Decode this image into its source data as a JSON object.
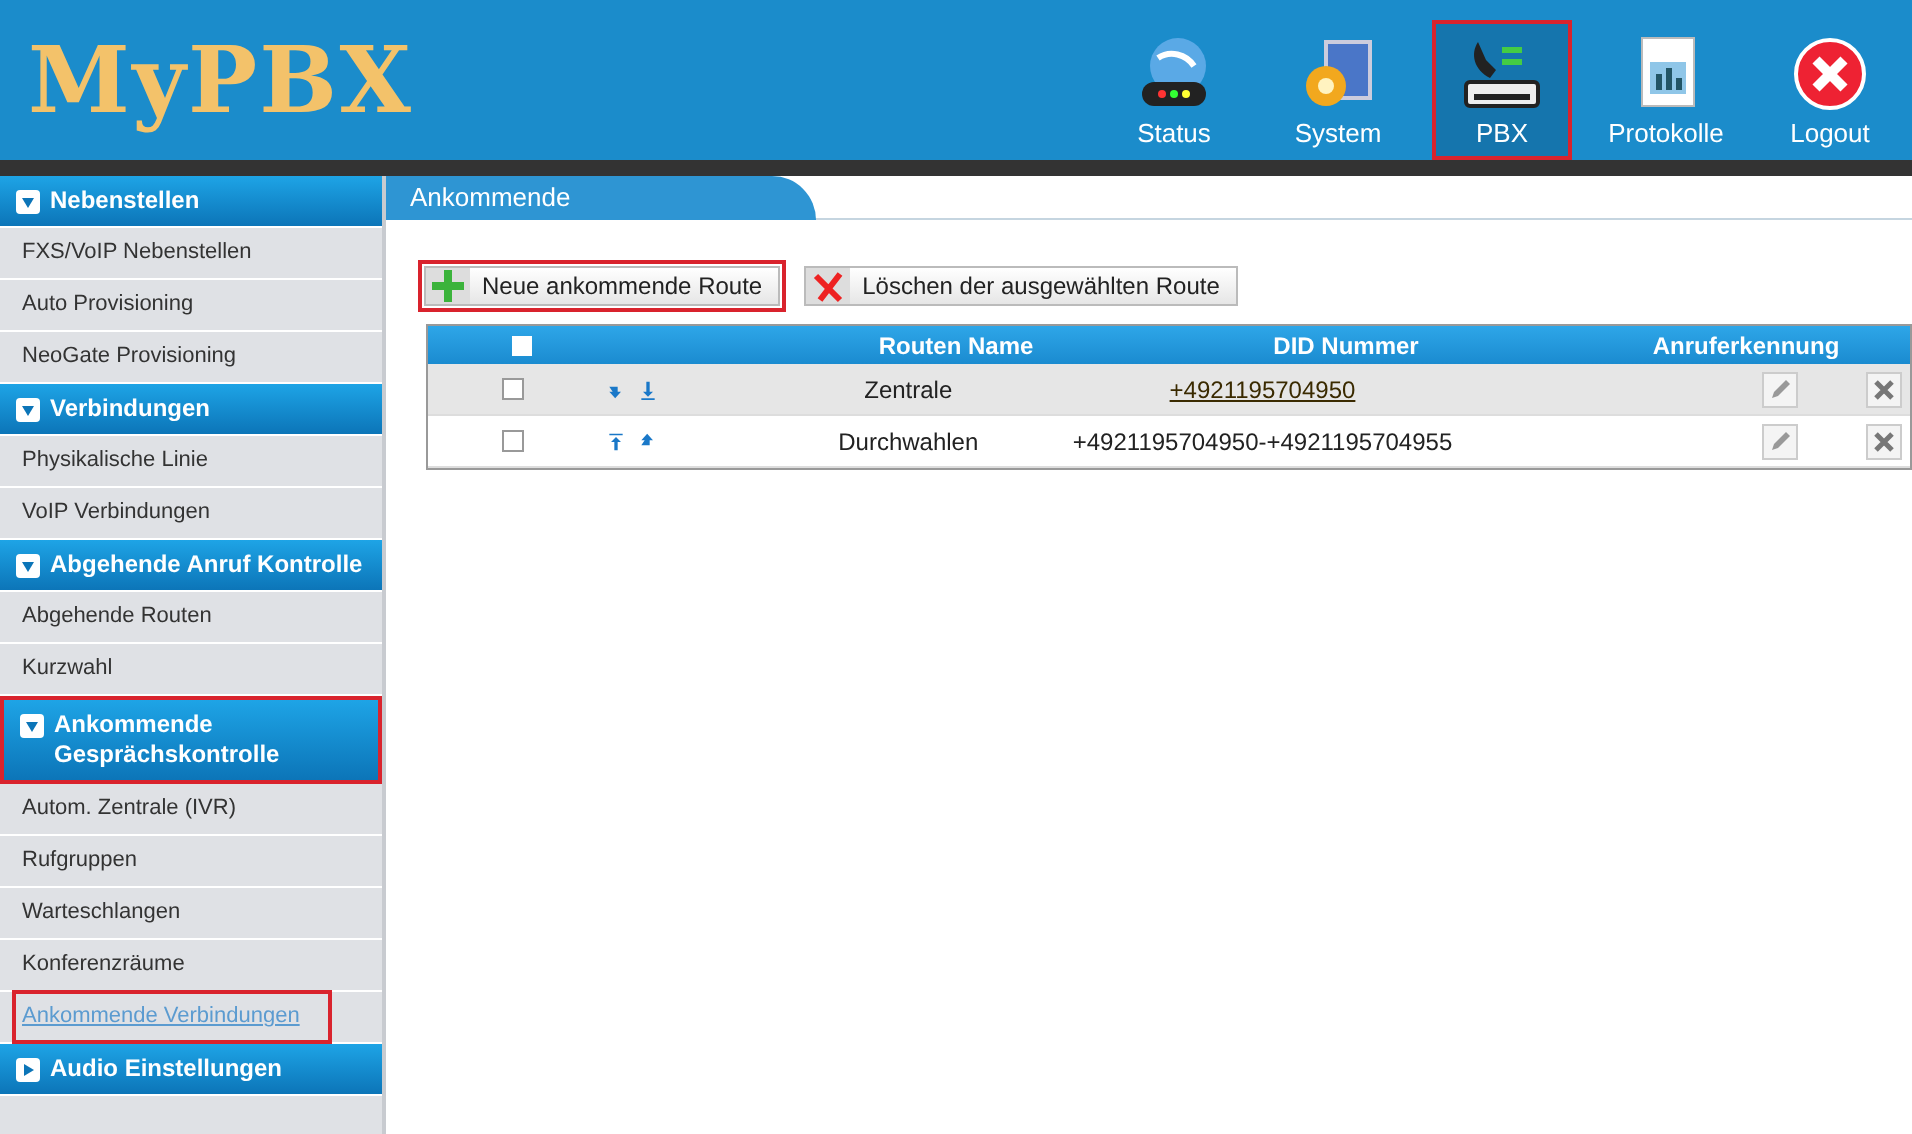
{
  "logo": "MyPBX",
  "nav": [
    {
      "label": "Status",
      "selected": false,
      "highlighted": false
    },
    {
      "label": "System",
      "selected": false,
      "highlighted": false
    },
    {
      "label": "PBX",
      "selected": true,
      "highlighted": true
    },
    {
      "label": "Protokolle",
      "selected": false,
      "highlighted": false
    },
    {
      "label": "Logout",
      "selected": false,
      "highlighted": false
    }
  ],
  "sidebar": [
    {
      "title": "Nebenstellen",
      "expanded": true,
      "highlighted": false,
      "items": [
        {
          "label": "FXS/VoIP Nebenstellen",
          "selected": false,
          "highlighted": false
        },
        {
          "label": "Auto Provisioning",
          "selected": false,
          "highlighted": false
        },
        {
          "label": "NeoGate Provisioning",
          "selected": false,
          "highlighted": false
        }
      ]
    },
    {
      "title": "Verbindungen",
      "expanded": true,
      "highlighted": false,
      "items": [
        {
          "label": "Physikalische Linie",
          "selected": false,
          "highlighted": false
        },
        {
          "label": "VoIP Verbindungen",
          "selected": false,
          "highlighted": false
        }
      ]
    },
    {
      "title": "Abgehende Anruf Kontrolle",
      "expanded": true,
      "highlighted": false,
      "items": [
        {
          "label": "Abgehende Routen",
          "selected": false,
          "highlighted": false
        },
        {
          "label": "Kurzwahl",
          "selected": false,
          "highlighted": false
        }
      ]
    },
    {
      "title": "Ankommende Gesprächskontrolle",
      "expanded": true,
      "highlighted": true,
      "items": [
        {
          "label": "Autom. Zentrale (IVR)",
          "selected": false,
          "highlighted": false
        },
        {
          "label": "Rufgruppen",
          "selected": false,
          "highlighted": false
        },
        {
          "label": "Warteschlangen",
          "selected": false,
          "highlighted": false
        },
        {
          "label": "Konferenzräume",
          "selected": false,
          "highlighted": false
        },
        {
          "label": "Ankommende Verbindungen",
          "selected": true,
          "highlighted": true
        }
      ]
    },
    {
      "title": "Audio Einstellungen",
      "expanded": false,
      "highlighted": false
    }
  ],
  "tab": {
    "label": "Ankommende"
  },
  "toolbar": [
    {
      "label": "Neue ankommende Route",
      "kind": "add",
      "highlighted": true
    },
    {
      "label": "Löschen der ausgewählten Route",
      "kind": "delete",
      "highlighted": false
    }
  ],
  "table": {
    "all_checked": false,
    "columns": [
      "Routen Name",
      "DID Nummer",
      "Anruferkennung"
    ],
    "rows": [
      {
        "checked": false,
        "name": "Zentrale",
        "did": "+4921195704950",
        "did_link": true
      },
      {
        "checked": false,
        "name": "Durchwahlen",
        "did": "+4921195704950-+4921195704955",
        "did_link": false
      }
    ]
  }
}
